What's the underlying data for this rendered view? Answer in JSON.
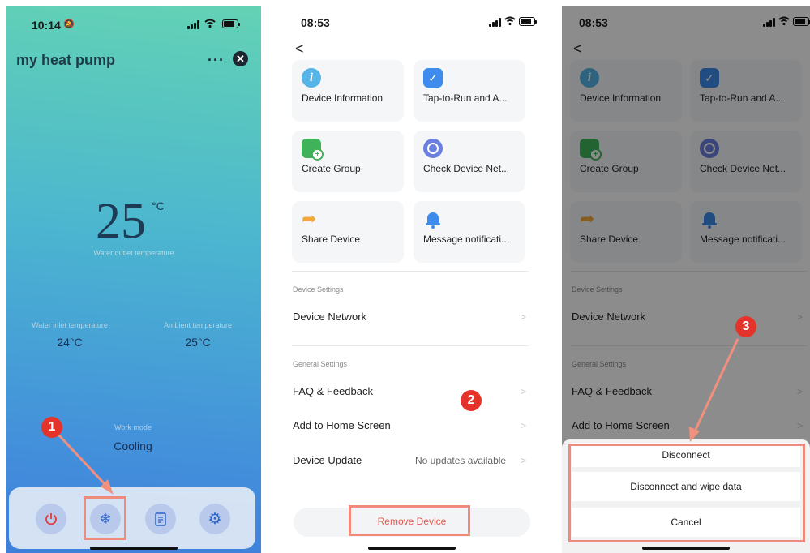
{
  "screen1": {
    "status_time": "10:14",
    "title": "my heat pump",
    "more_label": "···",
    "close_label": "✕",
    "temp_value": "25",
    "temp_unit": "°C",
    "temp_caption": "Water outlet temperature",
    "inlet_label": "Water inlet temperature",
    "inlet_value": "24°C",
    "ambient_label": "Ambient temperature",
    "ambient_value": "25°C",
    "mode_label": "Work mode",
    "mode_value": "Cooling",
    "marker": "1",
    "icons": {
      "power": "power-icon",
      "mode": "snowflake-icon",
      "log": "document-icon",
      "settings": "gear-icon"
    }
  },
  "screen2": {
    "status_time": "08:53",
    "back_label": "<",
    "cards": [
      {
        "label": "Device Information",
        "icon": "info-icon",
        "color": "#55b4e8"
      },
      {
        "label": "Tap-to-Run and A...",
        "icon": "checkmark-icon",
        "color": "#3d8bec"
      },
      {
        "label": "Create Group",
        "icon": "group-add-icon",
        "color": "#40b35a"
      },
      {
        "label": "Check Device Net...",
        "icon": "network-icon",
        "color": "#6b7fe0"
      },
      {
        "label": "Share Device",
        "icon": "share-arrow-icon",
        "color": "#f2a93b"
      },
      {
        "label": "Message notificati...",
        "icon": "bell-icon",
        "color": "#3d8bec"
      }
    ],
    "device_settings_header": "Device Settings",
    "device_network": "Device Network",
    "general_settings_header": "General Settings",
    "faq": "FAQ & Feedback",
    "add_home": "Add to Home Screen",
    "device_update": "Device Update",
    "update_status": "No updates available",
    "remove_device": "Remove Device",
    "marker": "2",
    "chevron": ">"
  },
  "screen3": {
    "status_time": "08:53",
    "back_label": "<",
    "cards": [
      {
        "label": "Device Information"
      },
      {
        "label": "Tap-to-Run and A..."
      },
      {
        "label": "Create Group"
      },
      {
        "label": "Check Device Net..."
      },
      {
        "label": "Share Device"
      },
      {
        "label": "Message notificati..."
      }
    ],
    "device_settings_header": "Device Settings",
    "device_network": "Device Network",
    "general_settings_header": "General Settings",
    "faq": "FAQ & Feedback",
    "add_home": "Add to Home Screen",
    "disconnect": "Disconnect",
    "disconnect_wipe": "Disconnect and wipe data",
    "cancel": "Cancel",
    "marker": "3",
    "chevron": ">"
  },
  "colors": {
    "highlight_box": "#ef8b7a",
    "marker": "#e4332a",
    "remove_text": "#e0594d",
    "overlay": "rgba(0,0,0,0.45)"
  }
}
